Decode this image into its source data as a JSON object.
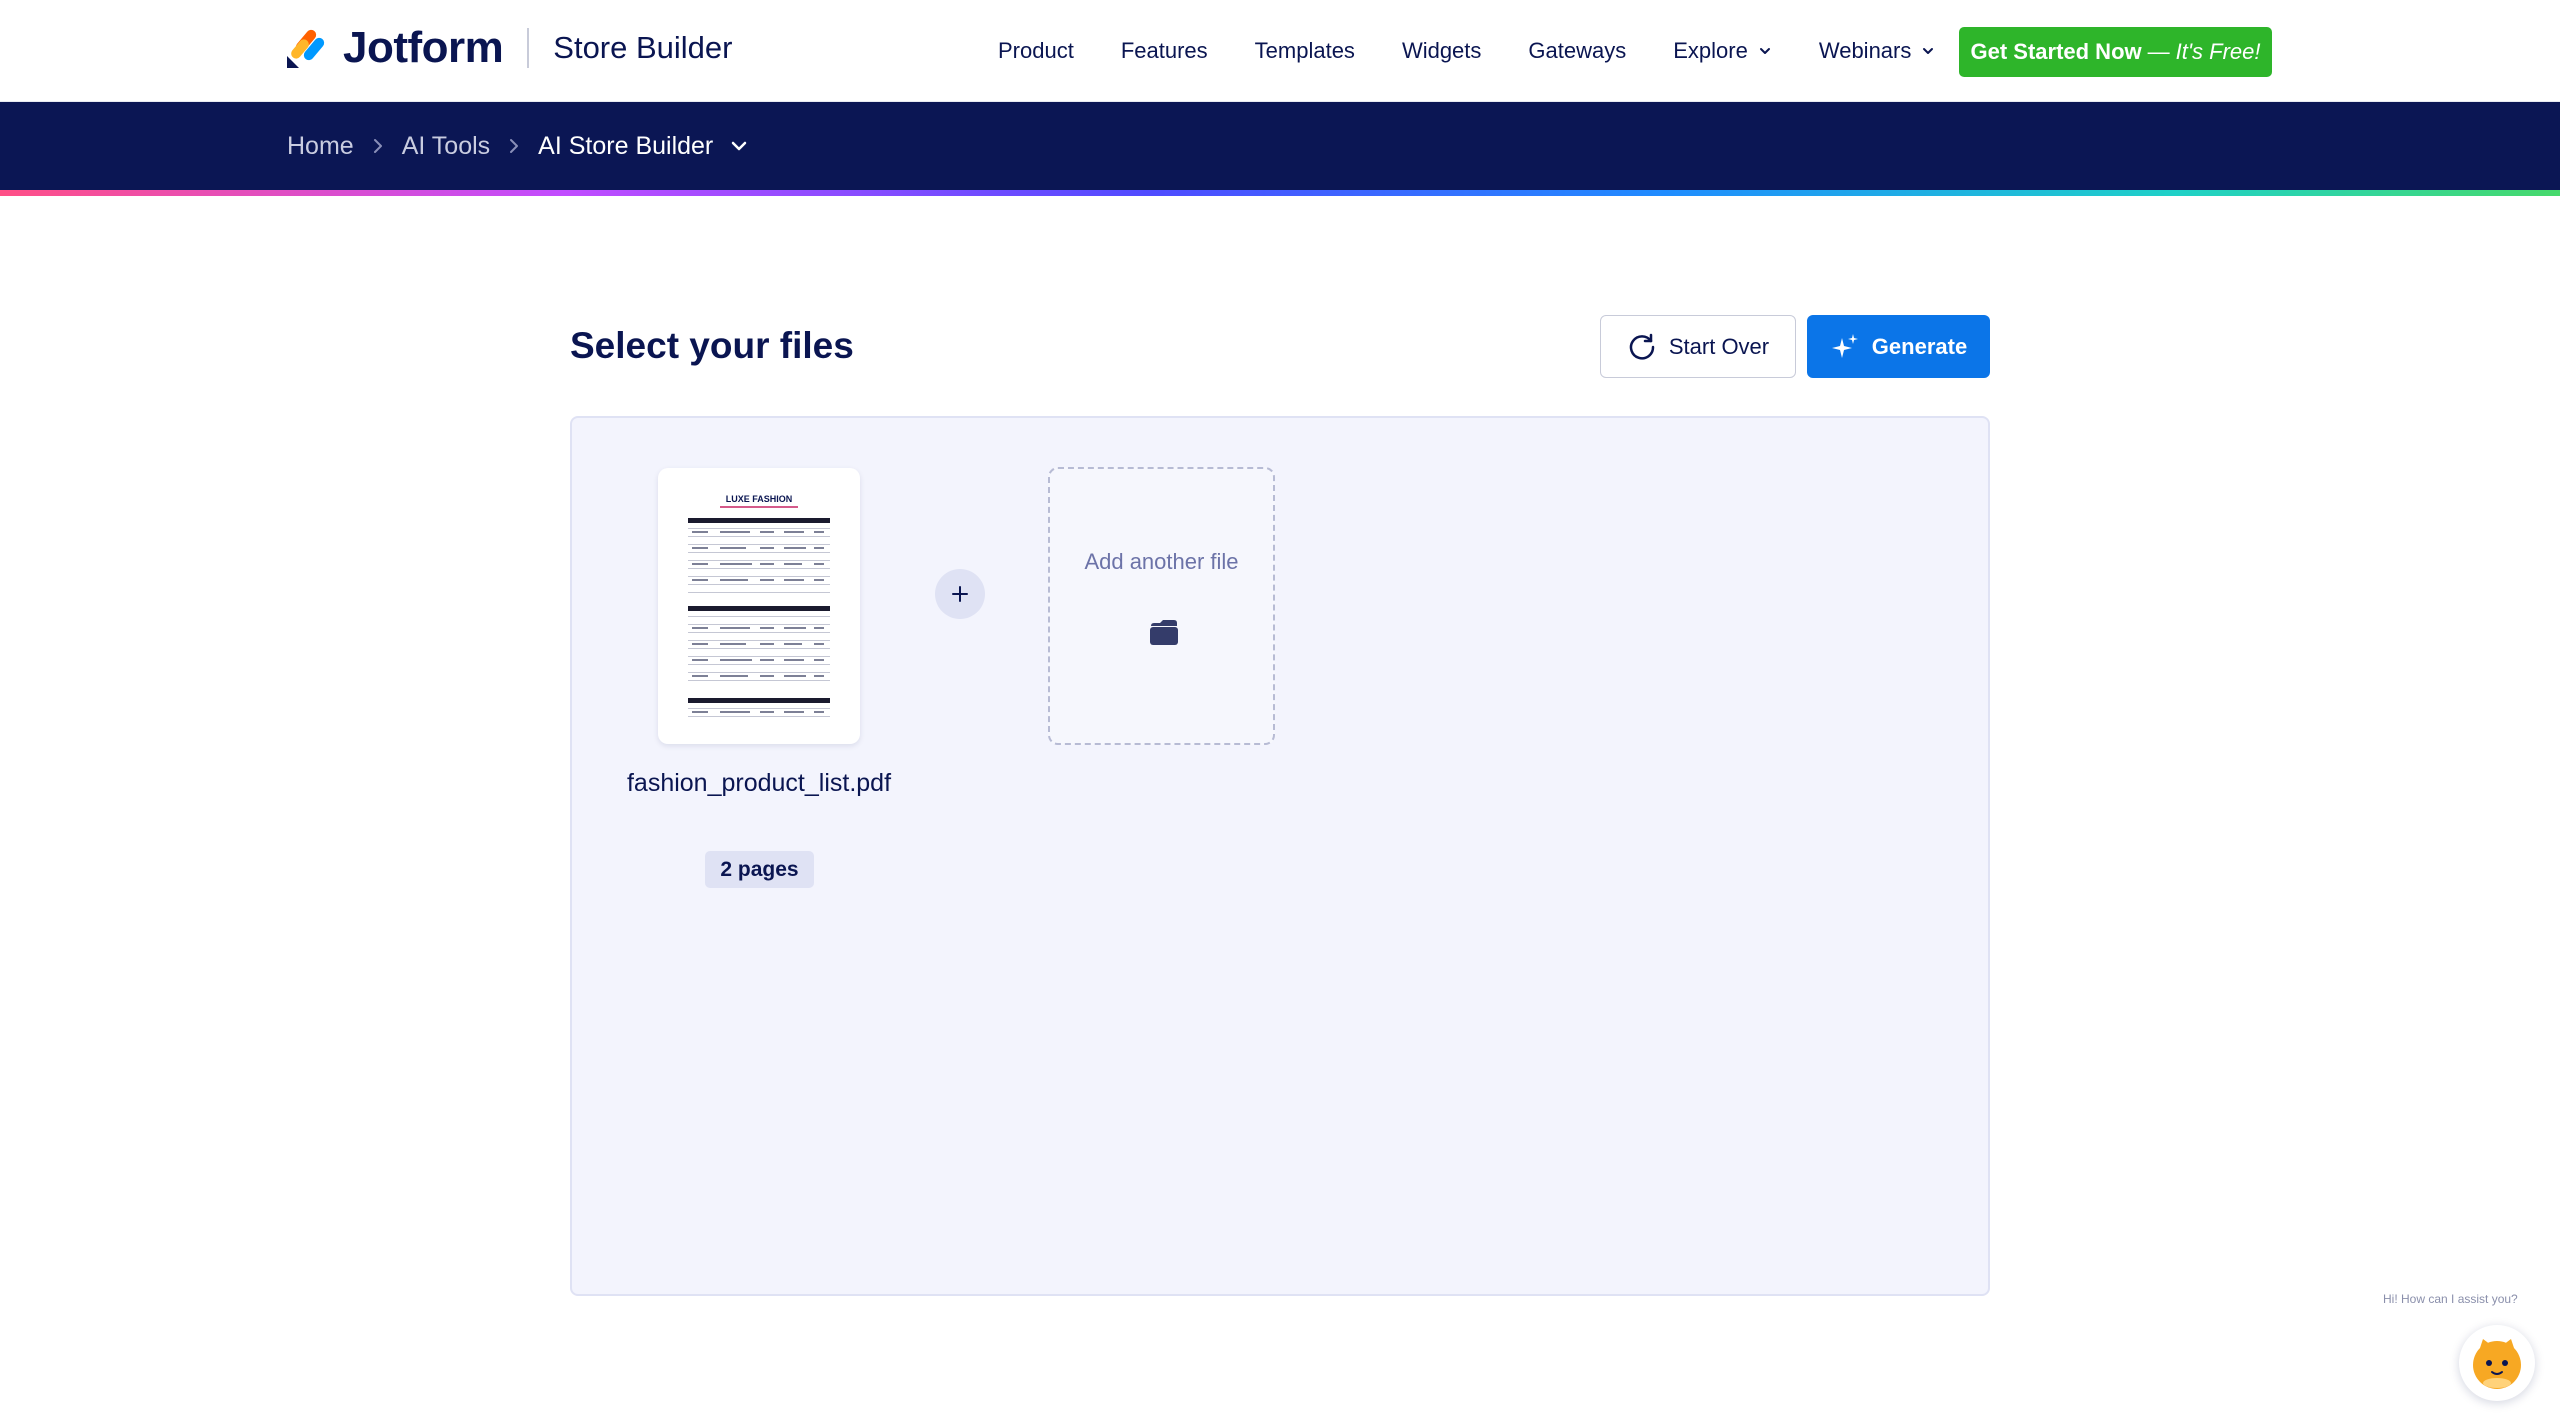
{
  "header": {
    "brand": "Jotform",
    "product": "Store Builder",
    "nav": [
      {
        "label": "Product"
      },
      {
        "label": "Features"
      },
      {
        "label": "Templates"
      },
      {
        "label": "Widgets"
      },
      {
        "label": "Gateways"
      },
      {
        "label": "Explore",
        "dropdown": true
      },
      {
        "label": "Webinars",
        "dropdown": true
      }
    ],
    "cta": {
      "main": "Get Started Now",
      "separator": "—",
      "free": "It's Free!"
    }
  },
  "breadcrumb": {
    "items": [
      "Home",
      "AI Tools",
      "AI Store Builder"
    ]
  },
  "main": {
    "title": "Select your files",
    "start_over": "Start Over",
    "generate": "Generate",
    "file": {
      "name": "fashion_product_list.pdf",
      "pages": "2 pages",
      "thumb_title": "LUXE FASHION"
    },
    "add_file": "Add another file"
  },
  "chat": {
    "hint": "Hi! How can I assist you?"
  },
  "colors": {
    "navy": "#0a1551",
    "crumb_bar": "#0b1654",
    "cta_green": "#2eb52a",
    "generate_blue": "#0b75e8",
    "dropzone_bg": "#f3f4fd"
  }
}
